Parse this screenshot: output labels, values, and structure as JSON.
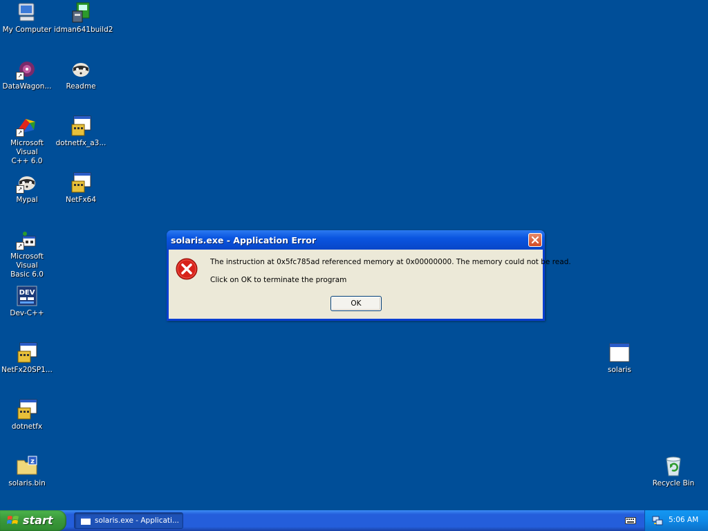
{
  "desktop": {
    "background_color": "#004e98",
    "icons": [
      {
        "label": "My Computer",
        "icon": "my-computer-icon"
      },
      {
        "label": "idman641build2",
        "icon": "installer-icon"
      },
      {
        "label": "DataWagon...",
        "icon": "datawagon-icon"
      },
      {
        "label": "Readme",
        "icon": "raccoon-icon"
      },
      {
        "label": "Microsoft Visual\nC++ 6.0",
        "icon": "visual-cpp-icon"
      },
      {
        "label": "dotnetfx_a3...",
        "icon": "setup-window-icon"
      },
      {
        "label": "Mypal",
        "icon": "raccoon-icon"
      },
      {
        "label": "NetFx64",
        "icon": "setup-window-icon"
      },
      {
        "label": "Microsoft Visual\nBasic 6.0",
        "icon": "visual-basic-icon"
      },
      {
        "label": "Dev-C++",
        "icon": "dev-cpp-icon"
      },
      {
        "label": "NetFx20SP1...",
        "icon": "setup-window-icon"
      },
      {
        "label": "dotnetfx",
        "icon": "setup-window-icon"
      },
      {
        "label": "solaris.bin",
        "icon": "zip-folder-icon"
      },
      {
        "label": "solaris",
        "icon": "app-window-icon"
      },
      {
        "label": "Recycle Bin",
        "icon": "recycle-bin-icon"
      }
    ]
  },
  "dialog": {
    "title": "solaris.exe - Application Error",
    "message": "The instruction at 0x5fc785ad referenced memory at 0x00000000. The memory could not be read.",
    "sub_message": "Click on OK to terminate the program",
    "ok_label": "OK",
    "icon": "error-icon"
  },
  "taskbar": {
    "start_label": "start",
    "task_label": "solaris.exe - Applicati...",
    "clock": "5:06 AM"
  }
}
